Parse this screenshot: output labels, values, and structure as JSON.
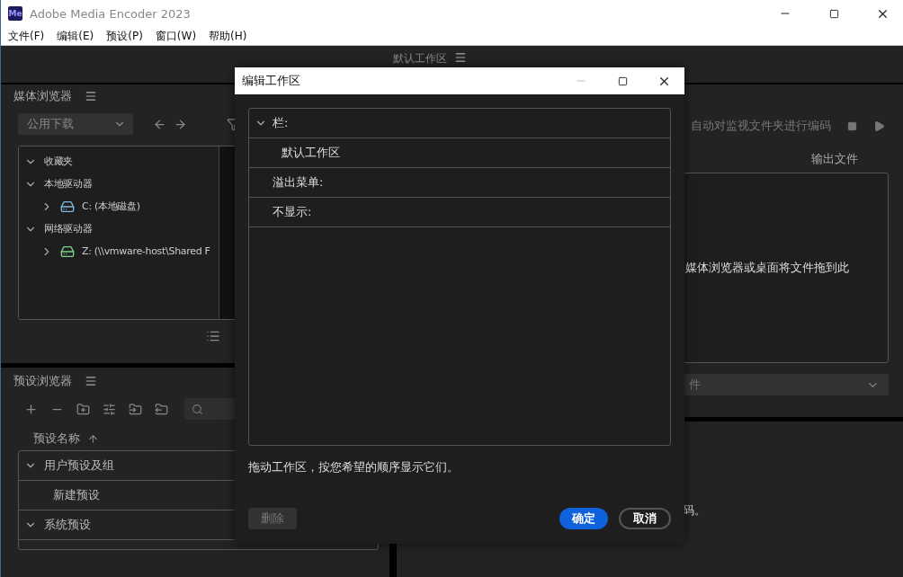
{
  "window": {
    "app_badge": "Me",
    "title": "Adobe Media Encoder 2023"
  },
  "menu": [
    "文件(F)",
    "编辑(E)",
    "预设(P)",
    "窗口(W)",
    "帮助(H)"
  ],
  "workspace_bar": {
    "label": "默认工作区"
  },
  "media_browser": {
    "title": "媒体浏览器",
    "location": "公用下载",
    "tree": [
      {
        "label": "收藏夹",
        "expanded": true
      },
      {
        "label": "本地驱动器",
        "expanded": true,
        "children": [
          {
            "label": "C: (本地磁盘)",
            "kind": "local",
            "expanded": false
          }
        ]
      },
      {
        "label": "网络驱动器",
        "expanded": true,
        "children": [
          {
            "label": "Z: (\\\\vmware-host\\Shared F",
            "kind": "network",
            "expanded": false
          }
        ]
      }
    ]
  },
  "preset_browser": {
    "title": "预设浏览器",
    "column": "预设名称",
    "rows": [
      {
        "label": "用户预设及组",
        "kind": "group",
        "expanded": true
      },
      {
        "label": "新建预设",
        "kind": "item"
      },
      {
        "label": "系统预设",
        "kind": "group",
        "expanded": true
      }
    ]
  },
  "queue": {
    "auto_encode": "自动对监视文件夹进行编码",
    "output_header": "输出文件",
    "drop_hint": "媒体浏览器或桌面将文件拖到此",
    "preset_select": "件",
    "bottom_hint": "码。"
  },
  "dialog": {
    "title": "编辑工作区",
    "rows": [
      {
        "label": "栏:",
        "kind": "section",
        "expanded": true
      },
      {
        "label": "默认工作区",
        "kind": "item"
      },
      {
        "label": "溢出菜单:",
        "kind": "section"
      },
      {
        "label": "不显示:",
        "kind": "section"
      }
    ],
    "hint": "拖动工作区，按您希望的顺序显示它们。",
    "buttons": [
      {
        "label": "删除",
        "kind": "plain",
        "disabled": true
      },
      {
        "label": "确定",
        "kind": "primary",
        "disabled": false
      },
      {
        "label": "取消",
        "kind": "outline",
        "disabled": false
      }
    ]
  }
}
